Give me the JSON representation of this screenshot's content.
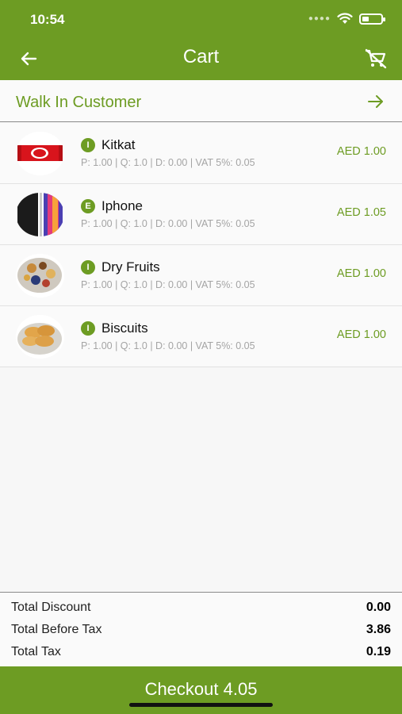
{
  "status_bar": {
    "time": "10:54",
    "battery_level": 0.35
  },
  "header": {
    "title": "Cart",
    "back_icon": "arrow-left-icon",
    "clear_icon": "cart-remove-icon"
  },
  "customer": {
    "name": "Walk In Customer",
    "arrow_icon": "arrow-right-icon"
  },
  "items": [
    {
      "badge": "I",
      "name": "Kitkat",
      "meta": "P: 1.00 | Q: 1.0 | D: 0.00 | VAT 5%: 0.05",
      "price": "AED 1.00",
      "image": "kitkat-image"
    },
    {
      "badge": "E",
      "name": "Iphone",
      "meta": "P: 1.00 | Q: 1.0 | D: 0.00 | VAT 5%: 0.05",
      "price": "AED 1.05",
      "image": "iphone-image"
    },
    {
      "badge": "I",
      "name": "Dry Fruits",
      "meta": "P: 1.00 | Q: 1.0 | D: 0.00 | VAT 5%: 0.05",
      "price": "AED 1.00",
      "image": "dry-fruits-image"
    },
    {
      "badge": "I",
      "name": "Biscuits",
      "meta": "P: 1.00 | Q: 1.0 | D: 0.00 | VAT 5%: 0.05",
      "price": "AED 1.00",
      "image": "biscuits-image"
    }
  ],
  "totals": [
    {
      "label": "Total Discount",
      "value": "0.00"
    },
    {
      "label": "Total Before Tax",
      "value": "3.86"
    },
    {
      "label": "Total Tax",
      "value": "0.19"
    }
  ],
  "checkout": {
    "label": "Checkout 4.05"
  },
  "colors": {
    "accent": "#6d9c23",
    "price": "#6d9c23",
    "meta": "#a4a4a4"
  }
}
